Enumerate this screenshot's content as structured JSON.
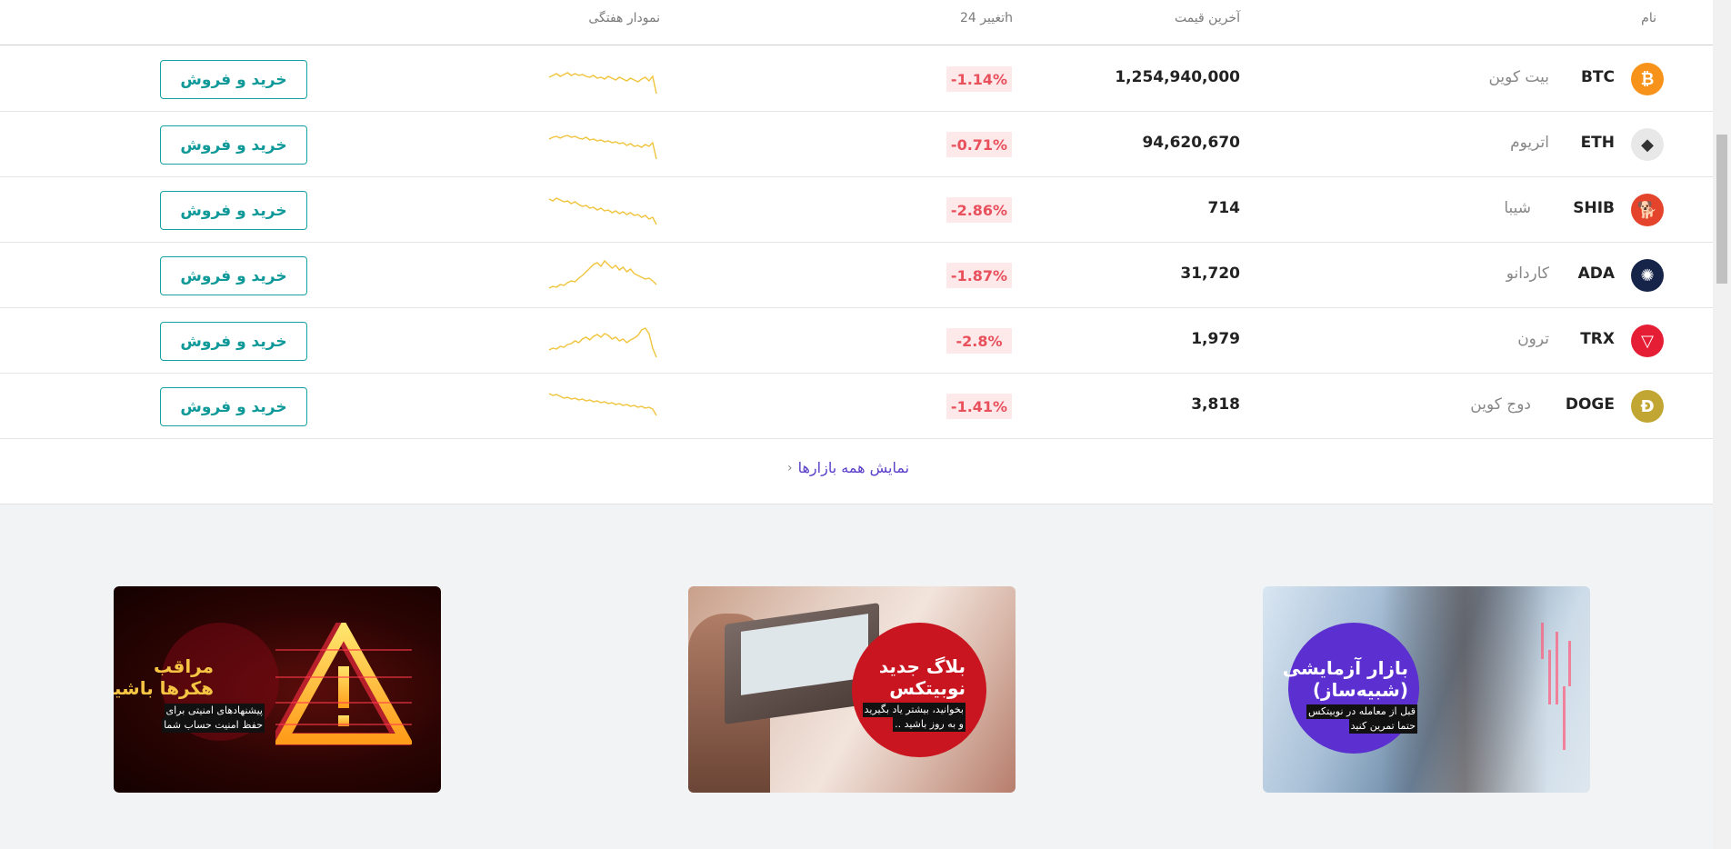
{
  "table": {
    "headers": {
      "name": "نام",
      "last_price": "آخرین قیمت",
      "change_24h": "تغییر 24h",
      "weekly_chart": "نمودار هفتگی"
    },
    "rows": [
      {
        "symbol": "BTC",
        "name": "بیت کوین",
        "price": "1,254,940,000",
        "change": "-1.14%",
        "icon_color": "#f7931a",
        "icon_glyph": "₿",
        "spark": [
          40,
          38,
          36,
          39,
          37,
          35,
          38,
          36,
          38,
          37,
          39,
          40,
          38,
          41,
          40,
          42,
          39,
          41,
          43,
          40,
          42,
          44,
          41,
          43,
          45,
          42,
          40,
          44,
          39,
          58
        ]
      },
      {
        "symbol": "ETH",
        "name": "اتریوم",
        "price": "94,620,670",
        "change": "-0.71%",
        "icon_color": "#e8e8e8",
        "icon_glyph": "◆",
        "spark": [
          36,
          34,
          33,
          35,
          33,
          32,
          34,
          33,
          35,
          36,
          34,
          37,
          36,
          38,
          37,
          39,
          38,
          40,
          39,
          41,
          40,
          43,
          41,
          44,
          43,
          45,
          42,
          44,
          40,
          58
        ]
      },
      {
        "symbol": "SHIB",
        "name": "شیبا",
        "price": "714",
        "change": "-2.86%",
        "icon_color": "#e5442c",
        "icon_glyph": "🐕",
        "spark": [
          30,
          32,
          29,
          31,
          33,
          32,
          35,
          33,
          36,
          38,
          37,
          40,
          39,
          42,
          40,
          43,
          42,
          45,
          43,
          46,
          44,
          47,
          45,
          48,
          47,
          50,
          48,
          52,
          50,
          58
        ]
      },
      {
        "symbol": "ADA",
        "name": "کاردانو",
        "price": "31,720",
        "change": "-1.87%",
        "icon_color": "#16244a",
        "icon_glyph": "✺",
        "spark": [
          56,
          54,
          55,
          52,
          53,
          50,
          48,
          49,
          45,
          42,
          38,
          34,
          30,
          28,
          32,
          26,
          30,
          34,
          31,
          36,
          33,
          38,
          35,
          40,
          42,
          44,
          46,
          45,
          48,
          52
        ]
      },
      {
        "symbol": "TRX",
        "name": "ترون",
        "price": "1,979",
        "change": "-2.8%",
        "icon_color": "#e51e36",
        "icon_glyph": "▽",
        "spark": [
          52,
          50,
          51,
          48,
          49,
          46,
          45,
          42,
          44,
          40,
          38,
          41,
          37,
          35,
          38,
          34,
          36,
          40,
          38,
          42,
          40,
          44,
          41,
          39,
          36,
          30,
          28,
          34,
          50,
          60
        ]
      },
      {
        "symbol": "DOGE",
        "name": "دوج کوین",
        "price": "3,818",
        "change": "-1.41%",
        "icon_color": "#c2a633",
        "icon_glyph": "Ð",
        "spark": [
          28,
          30,
          29,
          31,
          33,
          32,
          34,
          33,
          35,
          34,
          36,
          35,
          37,
          36,
          38,
          37,
          39,
          38,
          40,
          39,
          41,
          40,
          42,
          41,
          43,
          42,
          44,
          43,
          45,
          52
        ]
      }
    ],
    "trade_label": "خرید و فروش",
    "negative_color": "#e8505b",
    "spark_color": "#f0c43c"
  },
  "all_markets_link": "نمایش همه بازارها",
  "promos": [
    {
      "title_line1": "مراقب",
      "title_line2": "هکرها باشید",
      "sub_line1": "پیشنهادهای امنیتی برای",
      "sub_line2": "حفظ امنیت حساب شما",
      "title_color": "#f7c544"
    },
    {
      "title_line1": "بلاگ جدید",
      "title_line2": "نوبیتکس",
      "sub_line1": "بخوانید، بیشتر یاد بگیرید",
      "sub_line2": "و به روز باشید ..",
      "title_color": "#ffffff"
    },
    {
      "title_line1": "بازار آزمایشی",
      "title_line2": "(شبیه‌ساز)",
      "sub_line1": "قبل از معامله در نوبیتکس",
      "sub_line2": "حتما تمرین کنید",
      "title_color": "#ffffff"
    }
  ]
}
